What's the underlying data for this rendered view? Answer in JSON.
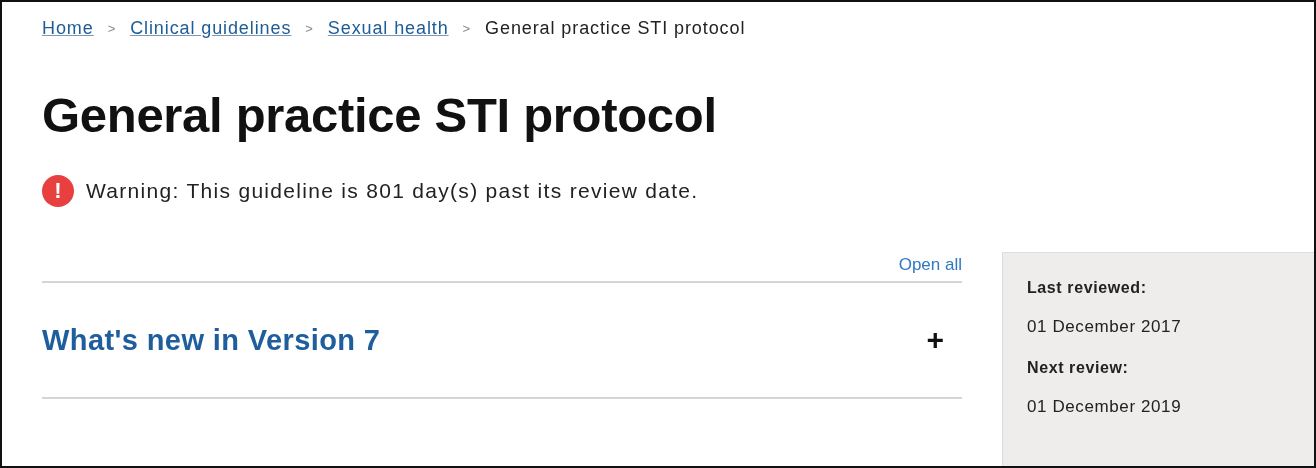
{
  "breadcrumb": [
    {
      "label": "Home",
      "link": true
    },
    {
      "label": "Clinical guidelines",
      "link": true
    },
    {
      "label": "Sexual health",
      "link": true
    },
    {
      "label": "General practice STI protocol",
      "link": false
    }
  ],
  "breadcrumb_separator": ">",
  "title": "General practice STI protocol",
  "warning": {
    "icon": "!",
    "text": "Warning: This guideline is 801 day(s) past its review date."
  },
  "open_all": "Open all",
  "accordion": [
    {
      "title": "What's new in Version 7",
      "expanded": false,
      "toggle": "+"
    }
  ],
  "sidebar": [
    {
      "label": "Last reviewed:",
      "value": "01 December 2017"
    },
    {
      "label": "Next review:",
      "value": "01 December 2019"
    }
  ]
}
